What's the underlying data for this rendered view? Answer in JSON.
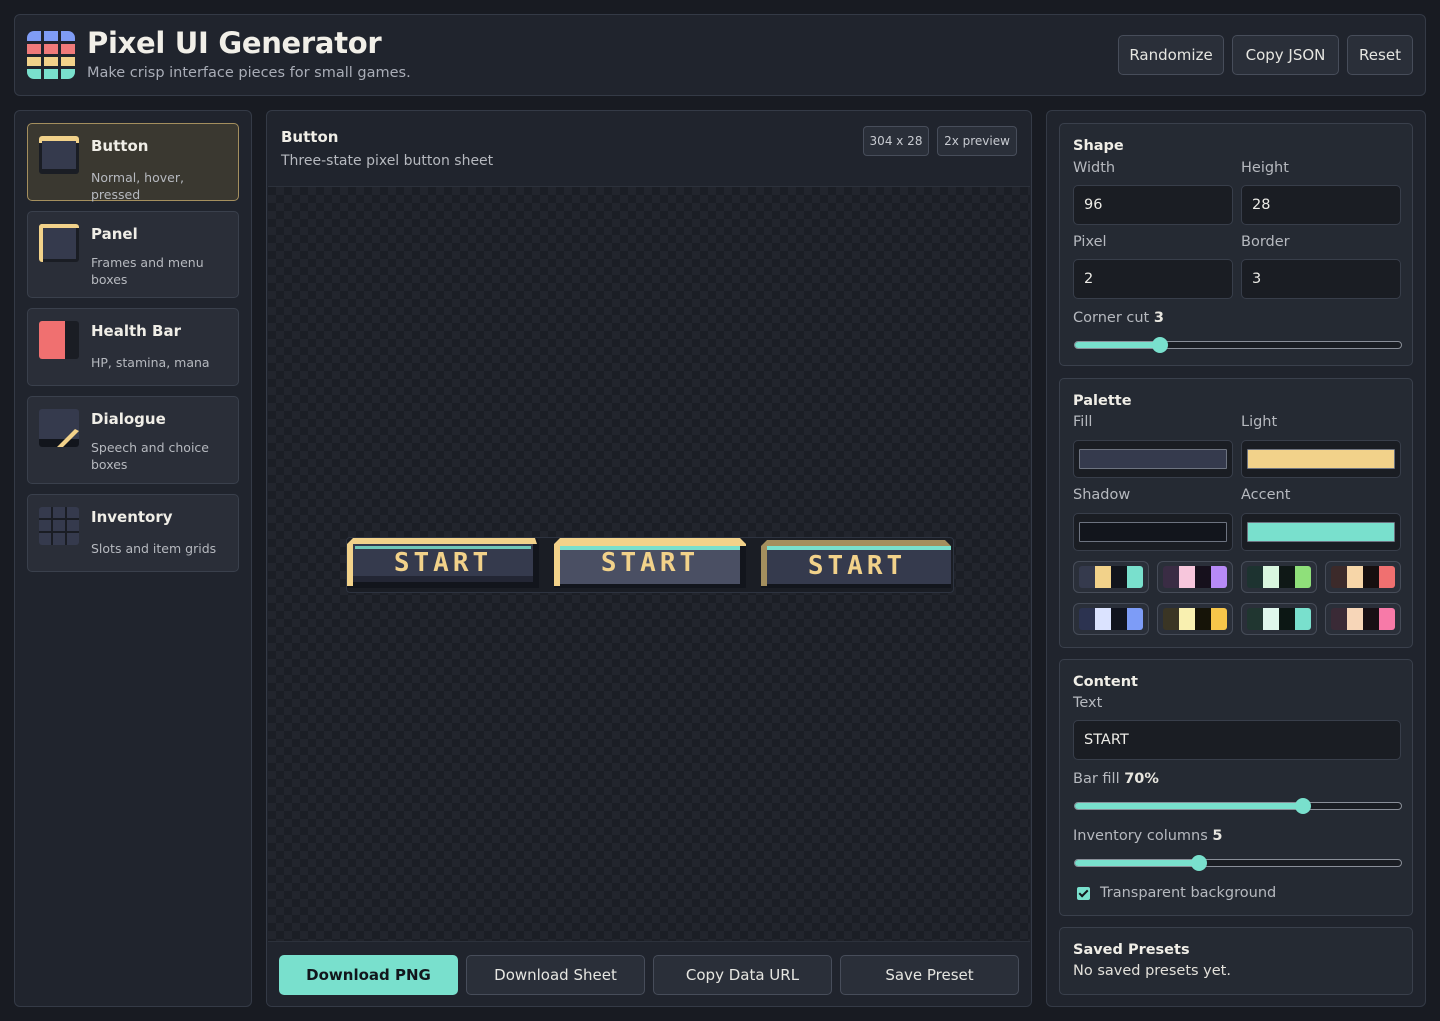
{
  "header": {
    "title": "Pixel UI Generator",
    "subtitle": "Make crisp interface pieces for small games.",
    "buttons": {
      "randomize": "Randomize",
      "copy_json": "Copy JSON",
      "reset": "Reset"
    },
    "logo_colors": [
      "#7f9cf5",
      "#7f9cf5",
      "#7f9cf5",
      "#f07a7a",
      "#f07a7a",
      "#f07a7a",
      "#f2d28a",
      "#f2d28a",
      "#f2d28a",
      "#79e0cd",
      "#79e0cd",
      "#79e0cd"
    ]
  },
  "sidebar": {
    "items": [
      {
        "title": "Button",
        "desc": "Normal, hover, pressed",
        "icon": "button-icon",
        "active": true
      },
      {
        "title": "Panel",
        "desc": "Frames and menu boxes",
        "icon": "panel-icon",
        "active": false
      },
      {
        "title": "Health Bar",
        "desc": "HP, stamina, mana",
        "icon": "health-bar-icon",
        "active": false
      },
      {
        "title": "Dialogue",
        "desc": "Speech and choice boxes",
        "icon": "dialogue-icon",
        "active": false
      },
      {
        "title": "Inventory",
        "desc": "Slots and item grids",
        "icon": "inventory-grid-icon",
        "active": false
      }
    ]
  },
  "preview": {
    "title": "Button",
    "subtitle": "Three-state pixel button sheet",
    "size_tag": "304 x 28",
    "zoom_tag": "2x preview",
    "button_states": [
      "normal",
      "hover",
      "pressed"
    ],
    "button_text": "START",
    "footer": {
      "download_png": "Download PNG",
      "download_sheet": "Download Sheet",
      "copy_data_url": "Copy Data URL",
      "save_preset": "Save Preset"
    }
  },
  "controls": {
    "shape": {
      "title": "Shape",
      "width_label": "Width",
      "width": "96",
      "height_label": "Height",
      "height": "28",
      "pixel_label": "Pixel",
      "pixel": "2",
      "border_label": "Border",
      "border": "3",
      "corner_label": "Corner cut",
      "corner": "3",
      "corner_fraction": 0.26
    },
    "palette": {
      "title": "Palette",
      "fill_label": "Fill",
      "fill": "#353a4d",
      "light_label": "Light",
      "light": "#f2d28a",
      "shadow_label": "Shadow",
      "shadow": "#12151c",
      "accent_label": "Accent",
      "accent": "#79e0cd",
      "presets": [
        [
          "#353a4d",
          "#f2d28a",
          "#12151c",
          "#79e0cd"
        ],
        [
          "#3a2c44",
          "#f7c6dc",
          "#16101c",
          "#b78af7"
        ],
        [
          "#1d3330",
          "#d9f7df",
          "#0f1816",
          "#8fe07a"
        ],
        [
          "#3c2a2a",
          "#f7d6a8",
          "#160f0f",
          "#f07070"
        ],
        [
          "#2c3350",
          "#dbe3ff",
          "#10131e",
          "#7d9cf7"
        ],
        [
          "#3a3524",
          "#f9f0b0",
          "#161408",
          "#f7c64a"
        ],
        [
          "#203630",
          "#dff7ec",
          "#0c1714",
          "#79e0cd"
        ],
        [
          "#3a2a36",
          "#f7d6b8",
          "#170f14",
          "#f77aa8"
        ]
      ]
    },
    "content": {
      "title": "Content",
      "text_label": "Text",
      "text": "START",
      "bar_fill_label": "Bar fill",
      "bar_fill": "70%",
      "bar_fill_fraction": 0.7,
      "inventory_label": "Inventory columns",
      "inventory_columns": "5",
      "inventory_fraction": 0.38,
      "transparent_label": "Transparent background",
      "transparent": true
    },
    "saved": {
      "title": "Saved Presets",
      "empty": "No saved presets yet."
    }
  }
}
